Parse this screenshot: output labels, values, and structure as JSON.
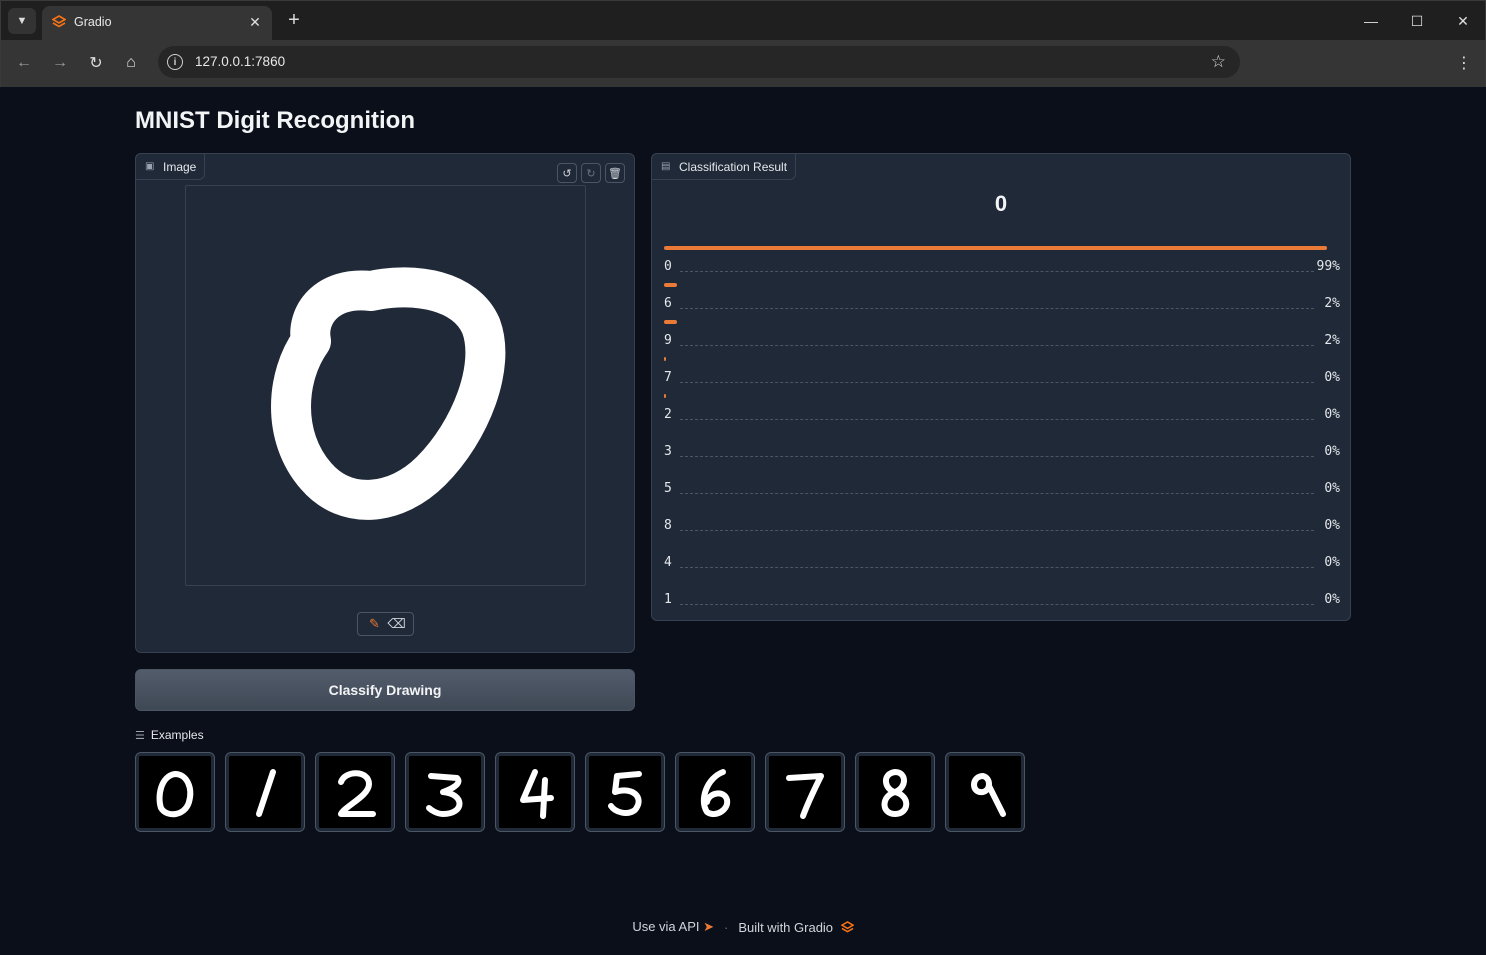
{
  "browser": {
    "tab_title": "Gradio",
    "url": "127.0.0.1:7860"
  },
  "app": {
    "title": "MNIST Digit Recognition"
  },
  "image_block": {
    "label": "Image"
  },
  "classify_button": "Classify Drawing",
  "result": {
    "label": "Classification Result",
    "top_label": "0",
    "accent_color": "#ea7a36",
    "confidences": [
      {
        "label": "0",
        "pct": "99%",
        "value": 0.99
      },
      {
        "label": "6",
        "pct": "2%",
        "value": 0.02
      },
      {
        "label": "9",
        "pct": "2%",
        "value": 0.02
      },
      {
        "label": "7",
        "pct": "0%",
        "value": 0.003
      },
      {
        "label": "2",
        "pct": "0%",
        "value": 0.002
      },
      {
        "label": "3",
        "pct": "0%",
        "value": 0
      },
      {
        "label": "5",
        "pct": "0%",
        "value": 0
      },
      {
        "label": "8",
        "pct": "0%",
        "value": 0
      },
      {
        "label": "4",
        "pct": "0%",
        "value": 0
      },
      {
        "label": "1",
        "pct": "0%",
        "value": 0
      }
    ]
  },
  "examples": {
    "label": "Examples",
    "items": [
      "0",
      "1",
      "2",
      "3",
      "4",
      "5",
      "6",
      "7",
      "8",
      "9"
    ]
  },
  "footer": {
    "api": "Use via API",
    "built": "Built with Gradio"
  }
}
